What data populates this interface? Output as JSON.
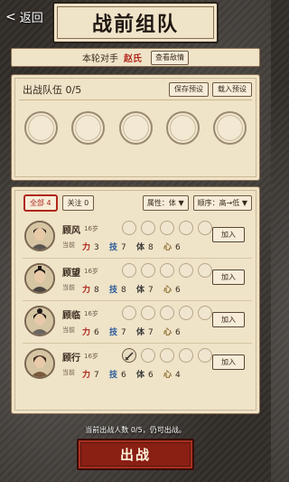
{
  "header": {
    "back_label": "返回",
    "title": "战前组队"
  },
  "opponent": {
    "label": "本轮对手",
    "name": "赵氏",
    "view_button": "查看敌情"
  },
  "team": {
    "label": "出战队伍 0/5",
    "save_button": "保存预设",
    "load_button": "载入预设",
    "slots_empty": 5
  },
  "filters": {
    "all_label": "全部 4",
    "follow_label": "关注 0",
    "attribute_label": "属性：体",
    "sort_label": "顺序：高→低"
  },
  "heroes": [
    {
      "name": "顾风",
      "age": "16岁",
      "status": "当前",
      "power": "3",
      "skill": "7",
      "body": "8",
      "mind": "6",
      "join": "加入",
      "gear_filled": 0,
      "icon": "female-portrait"
    },
    {
      "name": "顾望",
      "age": "16岁",
      "status": "当前",
      "power": "8",
      "skill": "8",
      "body": "7",
      "mind": "6",
      "join": "加入",
      "gear_filled": 0,
      "icon": "male-portrait"
    },
    {
      "name": "顾临",
      "age": "16岁",
      "status": "当前",
      "power": "6",
      "skill": "7",
      "body": "7",
      "mind": "6",
      "join": "加入",
      "gear_filled": 0,
      "icon": "female-portrait"
    },
    {
      "name": "顾行",
      "age": "16岁",
      "status": "当前",
      "power": "7",
      "skill": "6",
      "body": "6",
      "mind": "4",
      "join": "加入",
      "gear_filled": 1,
      "icon": "female-portrait"
    }
  ],
  "stat_labels": {
    "power": "力",
    "skill": "技",
    "body": "体",
    "mind": "心"
  },
  "footer": {
    "note": "当前出战人数 0/5，仍可出战。",
    "fight_button": "出战"
  }
}
